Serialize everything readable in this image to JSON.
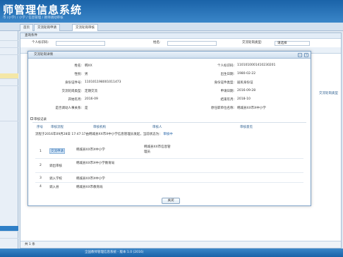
{
  "app": {
    "title": "师管理信息系统",
    "crumb": "市 (小学) / 小学 / 信息管理 / 教师调动审核"
  },
  "tabs": [
    "首页",
    "交流轮岗申请",
    "交流轮岗审核"
  ],
  "panel": {
    "header": "查询条件",
    "search": {
      "label1": "个人标识码:",
      "label2": "姓名:",
      "label3": "交流轮岗类型:",
      "select_value": "请选择"
    },
    "right_text": "交流轮岗类型",
    "pager_text": "共 1 条"
  },
  "dialog": {
    "title": "交流轮岗详情",
    "fields_left": [
      {
        "label": "姓名:",
        "value": "韩XX"
      },
      {
        "label": "性别:",
        "value": "男"
      },
      {
        "label": "身份证件号:",
        "value": "110101198001011473"
      },
      {
        "label": "交流轮岗类型:",
        "value": "定期交流"
      },
      {
        "label": "开始年月:",
        "value": "2016-09"
      },
      {
        "label": "是否调动人事关系:",
        "value": "是"
      }
    ],
    "fields_right": [
      {
        "label": "个人标识码:",
        "value": "1101010001410230201"
      },
      {
        "label": "出生日期:",
        "value": "1980-02-22"
      },
      {
        "label": "身份证件类型:",
        "value": "居民身份证"
      },
      {
        "label": "申请日期:",
        "value": "2016-09-28"
      },
      {
        "label": "结束年月:",
        "value": "2018-10"
      },
      {
        "label": "原任职单位名称:",
        "value": "韩城县XX市X中小学"
      }
    ],
    "section_title": "审核记录",
    "table_headers": [
      "序号",
      "审核流程",
      "审核机构",
      "审核人",
      "审核意见"
    ],
    "note": "流程于2016年09月28日 17:47:17由韩城县XX市X中小学信息管理员发起，当前状态为：",
    "note_link": "审核中",
    "rows": [
      {
        "no": "1",
        "step": "交流申请",
        "org": "韩城县XX市X中小学",
        "person": "韩城县XX市信息管理员"
      },
      {
        "no": "2",
        "step": "调出审核",
        "org": "韩城县XX市X中小学教育局",
        "person": ""
      },
      {
        "no": "3",
        "step": "调入学校",
        "org": "韩城县XX市X中小学",
        "person": ""
      },
      {
        "no": "4",
        "step": "调入县",
        "org": "韩城县XX市教育局",
        "person": ""
      }
    ],
    "close_label": "关闭"
  },
  "statusbar": "全国教师管理信息系统 - 版本 1.0 (2016)"
}
